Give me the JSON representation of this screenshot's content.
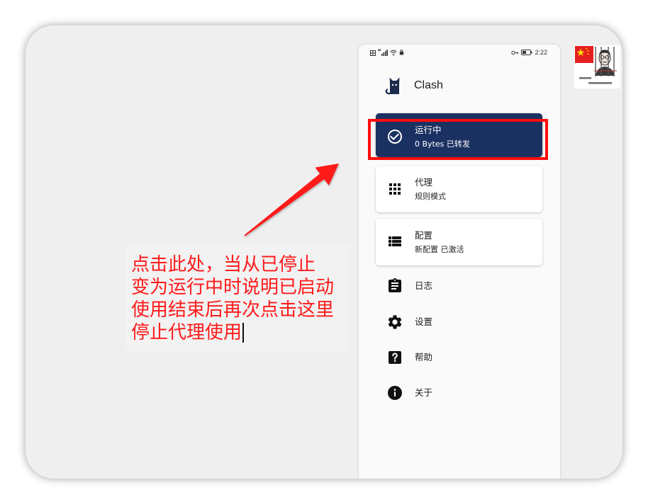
{
  "status_bar": {
    "time": "2:22",
    "icons_left": [
      "hd-icon",
      "signal-icon",
      "wifi-icon",
      "notification-icon"
    ],
    "icons_right": [
      "key-icon",
      "battery-icon"
    ]
  },
  "app": {
    "title": "Clash",
    "logo_icon": "cat-logo-icon",
    "logo_color": "#1c2b4b"
  },
  "status_card": {
    "title": "运行中",
    "subtitle": "0 Bytes 已转发",
    "icon": "check-circle-icon",
    "color": "#1b3162",
    "highlight_color": "#ff0d0d"
  },
  "proxy_card": {
    "title": "代理",
    "subtitle": "规则模式",
    "icon": "apps-grid-icon"
  },
  "profile_card": {
    "title": "配置",
    "subtitle": "新配置 已激活",
    "icon": "view-list-icon"
  },
  "menu": [
    {
      "label": "日志",
      "icon": "clipboard-icon"
    },
    {
      "label": "设置",
      "icon": "gear-icon"
    },
    {
      "label": "帮助",
      "icon": "help-icon"
    },
    {
      "label": "关于",
      "icon": "info-icon"
    }
  ],
  "annotation": {
    "lines": [
      "点击此处，当从已停止",
      "变为运行中时说明已启动",
      "使用结束后再次点击这里",
      "停止代理使用"
    ],
    "color": "#ff1a1a",
    "arrow_icon": "red-arrow-icon"
  },
  "sticker": {
    "icon": "avatar-sticker-image",
    "flag_color": "#e41f1f",
    "star_color": "#ffde00"
  }
}
